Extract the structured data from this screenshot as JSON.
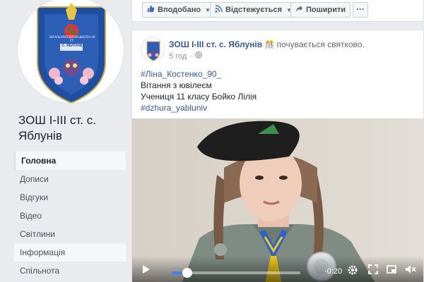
{
  "page": {
    "name": "ЗОШ І-ІІІ ст. с. Яблунів",
    "logo_text_top": "ЗАГАЛЬНООСВІТНЯ ШКОЛА І-ІІІ СТ.",
    "logo_text_bottom": "С. ЯБЛУНІВ"
  },
  "nav": {
    "items": [
      {
        "label": "Головна"
      },
      {
        "label": "Дописи"
      },
      {
        "label": "Відгуки"
      },
      {
        "label": "Відео"
      },
      {
        "label": "Світлини"
      },
      {
        "label": "Інформація"
      },
      {
        "label": "Спільнота"
      }
    ]
  },
  "actions": {
    "liked": "Вподобано",
    "following": "Відстежується",
    "share": "Поширити",
    "more": "···"
  },
  "post": {
    "author": "ЗОШ І-ІІІ ст. с. Яблунів",
    "feeling": "почувається святково.",
    "time": "5 год",
    "lines": {
      "tag1": "#Ліна_Костенко_90_",
      "line2": "Вітання з ювілеєм",
      "line3": "Учениця 11 класу Бойко Лілія",
      "tag2": "#dzhura_yabluniv"
    }
  },
  "video": {
    "time_remaining": "-0:20",
    "progress": 0.12
  },
  "colors": {
    "link": "#385898",
    "progress": "#4080ff",
    "page_bg": "#e9ebee"
  }
}
